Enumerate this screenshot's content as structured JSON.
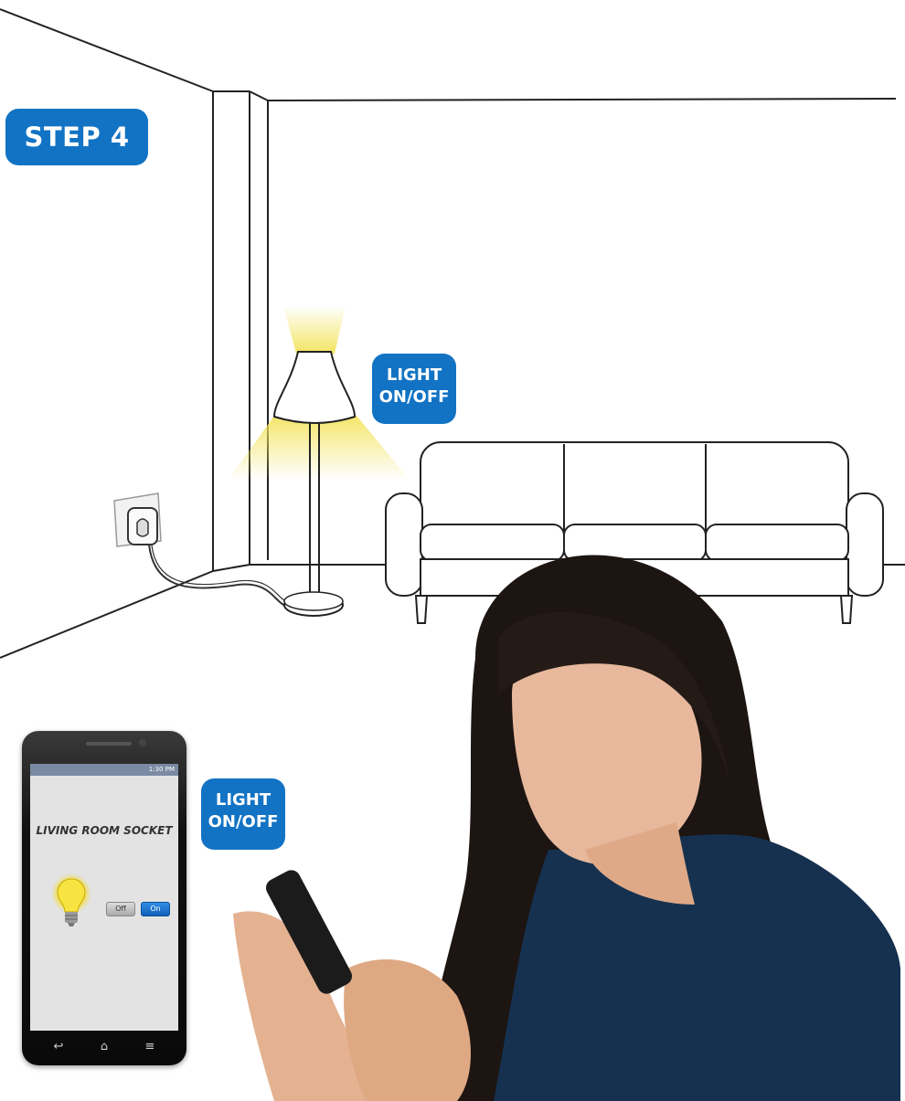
{
  "step_badge": "STEP 4",
  "lamp_badge": {
    "line1": "LIGHT",
    "line2": "ON/OFF"
  },
  "phone_badge": {
    "line1": "LIGHT",
    "line2": "ON/OFF"
  },
  "phone": {
    "status_time": "1:30 PM",
    "socket_title": "LIVING ROOM SOCKET",
    "off_label": "Off",
    "on_label": "On",
    "nav_icons": [
      "back-icon",
      "home-icon",
      "menu-icon"
    ]
  },
  "colors": {
    "badge_blue": "#1273c4",
    "lamp_glow": "#f7e87a",
    "hair": "#1c1512",
    "sweater": "#16314f"
  }
}
